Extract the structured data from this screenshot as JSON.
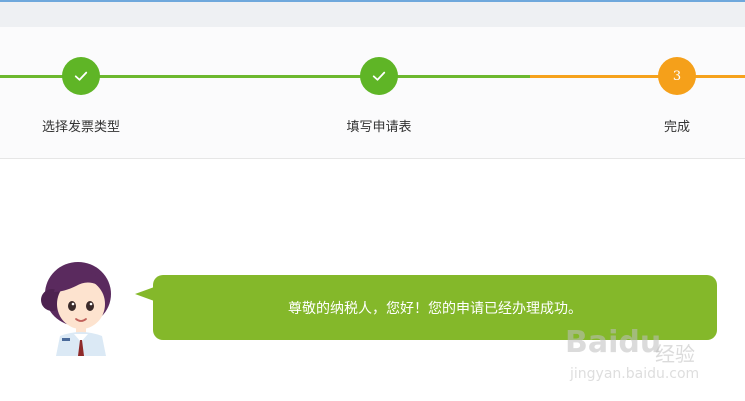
{
  "steps": [
    {
      "label": "选择发票类型",
      "state": "done",
      "icon": "check-icon"
    },
    {
      "label": "填写申请表",
      "state": "done",
      "icon": "check-icon"
    },
    {
      "label": "完成",
      "state": "active",
      "number": "3"
    }
  ],
  "message": "尊敬的纳税人，您好！您的申请已经办理成功。",
  "watermark": {
    "logo": "Baidu",
    "jingyan": "经验",
    "url": "jingyan.baidu.com"
  },
  "colors": {
    "done": "#5fb526",
    "active": "#f5a01a",
    "bubble": "#84b82a"
  }
}
